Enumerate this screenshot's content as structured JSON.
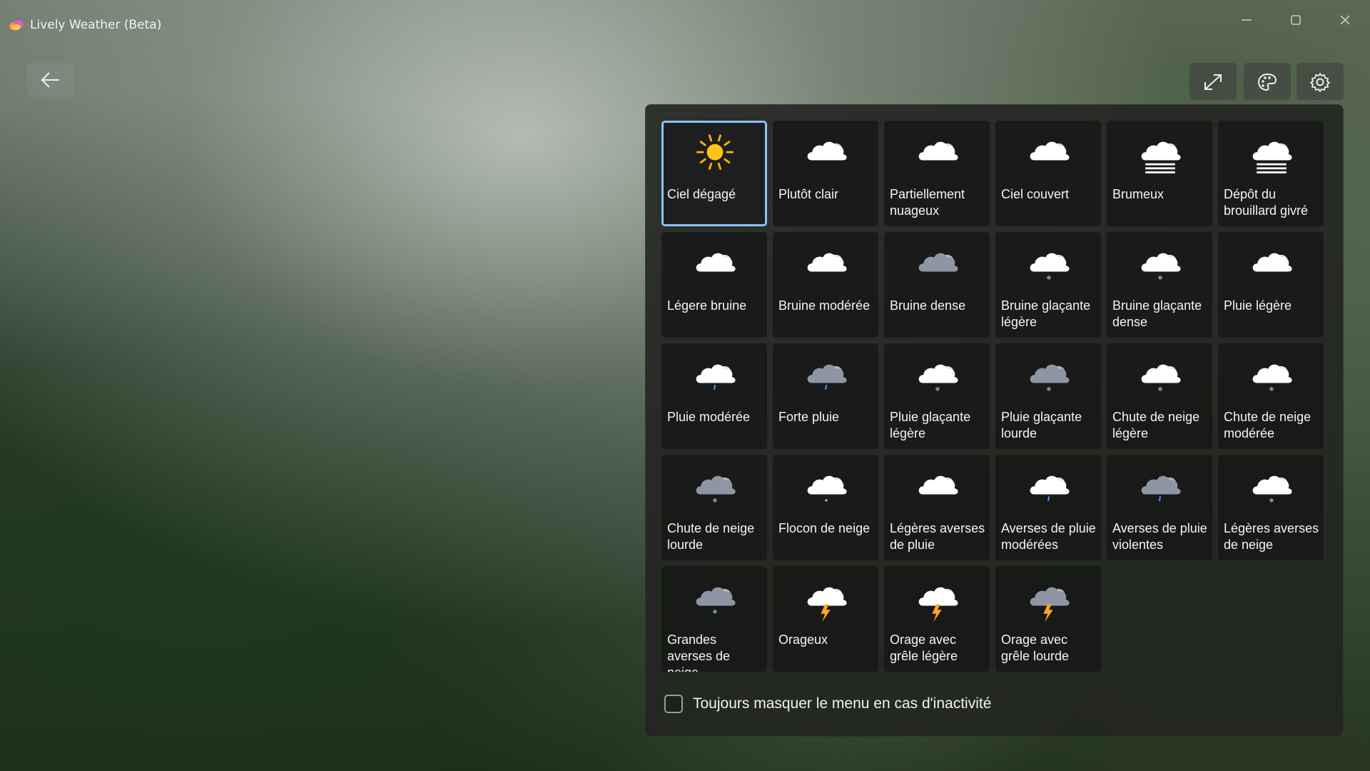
{
  "window": {
    "title": "Lively Weather (Beta)",
    "app_icon": "lively-color-logo-icon",
    "controls": [
      "minimize-icon",
      "maximize-icon",
      "close-icon"
    ]
  },
  "toolbar": {
    "back": "arrow-left-icon",
    "expand": "expand-diagonal-icon",
    "theme": "palette-icon",
    "settings": "gear-icon"
  },
  "selection_color": "#8dc3f2",
  "conditions": [
    {
      "label": "Ciel dégagé",
      "icon": "sun-icon",
      "selected": true
    },
    {
      "label": "Plutôt clair",
      "icon": "cloud-icon"
    },
    {
      "label": "Partiellement nuageux",
      "icon": "cloud-icon"
    },
    {
      "label": "Ciel couvert",
      "icon": "cloud-overcast-icon"
    },
    {
      "label": "Brumeux",
      "icon": "fog-icon"
    },
    {
      "label": "Dépôt du brouillard givré",
      "icon": "fog-icon"
    },
    {
      "label": "Légere bruine",
      "icon": "cloud-icon"
    },
    {
      "label": "Bruine modérée",
      "icon": "cloud-icon"
    },
    {
      "label": "Bruine dense",
      "icon": "dark-cloud-icon"
    },
    {
      "label": "Bruine glaçante légère",
      "icon": "cloud-snow-icon"
    },
    {
      "label": "Bruine glaçante dense",
      "icon": "cloud-snow-icon"
    },
    {
      "label": "Pluie légère",
      "icon": "cloud-icon"
    },
    {
      "label": "Pluie modérée",
      "icon": "cloud-rain-icon"
    },
    {
      "label": "Forte pluie",
      "icon": "dark-cloud-rain-icon"
    },
    {
      "label": "Pluie glaçante légère",
      "icon": "cloud-snow-icon"
    },
    {
      "label": "Pluie glaçante lourde",
      "icon": "dark-cloud-snow-icon"
    },
    {
      "label": "Chute de neige légère",
      "icon": "cloud-snow-icon"
    },
    {
      "label": "Chute de neige modérée",
      "icon": "cloud-snow-icon"
    },
    {
      "label": "Chute de neige lourde",
      "icon": "dark-cloud-snow-icon"
    },
    {
      "label": "Flocon de neige",
      "icon": "cloud-flake-icon"
    },
    {
      "label": "Légères averses de pluie",
      "icon": "cloud-icon"
    },
    {
      "label": "Averses de pluie modérées",
      "icon": "cloud-rain-icon"
    },
    {
      "label": "Averses de pluie violentes",
      "icon": "dark-cloud-rain-icon"
    },
    {
      "label": "Légères averses de neige",
      "icon": "cloud-snow-icon"
    },
    {
      "label": "Grandes averses de neige",
      "icon": "dark-cloud-snow-icon"
    },
    {
      "label": "Orageux",
      "icon": "cloud-lightning-icon"
    },
    {
      "label": "Orage avec grêle légère",
      "icon": "cloud-lightning-icon"
    },
    {
      "label": "Orage avec grêle lourde",
      "icon": "dark-cloud-lightning-icon"
    }
  ],
  "footer": {
    "checkbox_label": "Toujours masquer le menu en cas d'inactivité",
    "checked": false
  }
}
